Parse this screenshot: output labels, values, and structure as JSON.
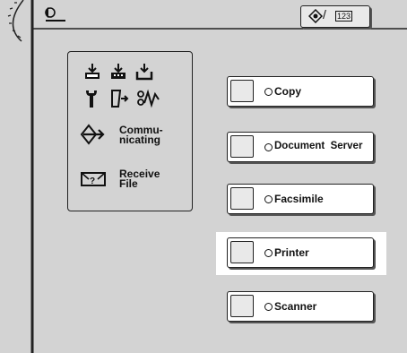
{
  "panel": {
    "top_indicator_text": "123",
    "indicators": [
      {
        "icon": "data-in-icon"
      },
      {
        "icon": "data-in-toner-icon"
      },
      {
        "icon": "data-in-tray-icon"
      },
      {
        "icon": "wrench-icon"
      },
      {
        "icon": "paper-jam-icon"
      },
      {
        "icon": "signal-icon"
      }
    ],
    "communicating_line1": "Commu-",
    "communicating_line2": "nicating",
    "receive_line1": "Receive",
    "receive_line2": "File"
  },
  "modes": [
    {
      "label": "Copy",
      "highlighted": false
    },
    {
      "label": "Document  Server",
      "highlighted": false
    },
    {
      "label": "Facsimile",
      "highlighted": false
    },
    {
      "label": "Printer",
      "highlighted": true
    },
    {
      "label": "Scanner",
      "highlighted": false
    }
  ],
  "colors": {
    "panel_background": "#d3d3d3",
    "highlight_background": "#ffffff",
    "key_gray": "#e9e9e9"
  }
}
